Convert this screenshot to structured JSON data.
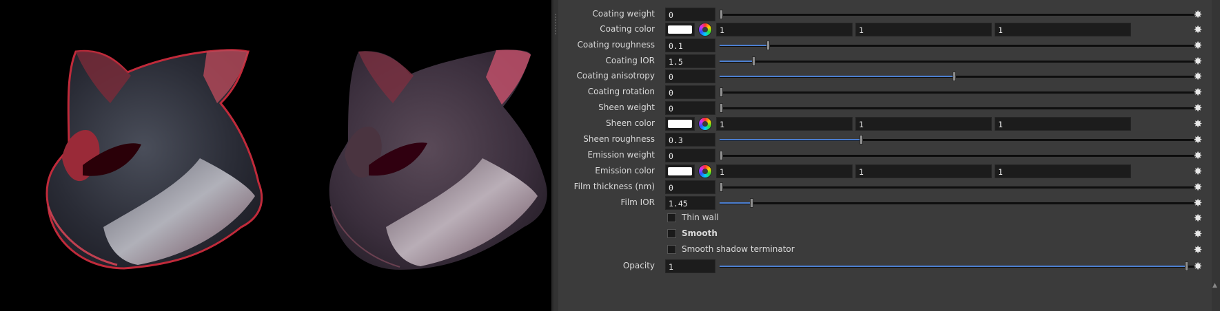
{
  "viewport": {
    "background": "#000000",
    "objects": [
      "low-poly-head-render",
      "smooth-head-render"
    ]
  },
  "params": [
    {
      "label": "Coating weight",
      "type": "slider",
      "value": "0",
      "fraction": 0.0
    },
    {
      "label": "Coating color",
      "type": "color",
      "swatch": "#ffffff",
      "components": [
        "1",
        "1",
        "1"
      ]
    },
    {
      "label": "Coating roughness",
      "type": "slider",
      "value": "0.1",
      "fraction": 0.1
    },
    {
      "label": "Coating IOR",
      "type": "slider",
      "value": "1.5",
      "fraction": 0.07
    },
    {
      "label": "Coating anisotropy",
      "type": "slider",
      "value": "0",
      "fraction": 0.5
    },
    {
      "label": "Coating rotation",
      "type": "slider",
      "value": "0",
      "fraction": 0.0
    },
    {
      "label": "Sheen weight",
      "type": "slider",
      "value": "0",
      "fraction": 0.0
    },
    {
      "label": "Sheen color",
      "type": "color",
      "swatch": "#ffffff",
      "components": [
        "1",
        "1",
        "1"
      ]
    },
    {
      "label": "Sheen roughness",
      "type": "slider",
      "value": "0.3",
      "fraction": 0.3
    },
    {
      "label": "Emission weight",
      "type": "slider",
      "value": "0",
      "fraction": 0.0
    },
    {
      "label": "Emission color",
      "type": "color",
      "swatch": "#ffffff",
      "components": [
        "1",
        "1",
        "1"
      ]
    },
    {
      "label": "Film thickness (nm)",
      "type": "slider",
      "value": "0",
      "fraction": 0.0
    },
    {
      "label": "Film IOR",
      "type": "slider",
      "value": "1.45",
      "fraction": 0.065
    },
    {
      "label": "Thin wall",
      "type": "checkbox",
      "checked": false,
      "bold": false
    },
    {
      "label": "Smooth",
      "type": "checkbox",
      "checked": false,
      "bold": true
    },
    {
      "label": "Smooth shadow terminator",
      "type": "checkbox",
      "checked": false,
      "bold": false
    },
    {
      "label": "Opacity",
      "type": "slider",
      "value": "1",
      "fraction": 1.0
    }
  ],
  "icons": {
    "gear": "gear-icon",
    "color_wheel": "color-wheel-icon"
  },
  "colors": {
    "slider_fill": "#4c7fd1",
    "panel_bg": "#3b3b3b",
    "field_bg": "#1c1c1c"
  }
}
